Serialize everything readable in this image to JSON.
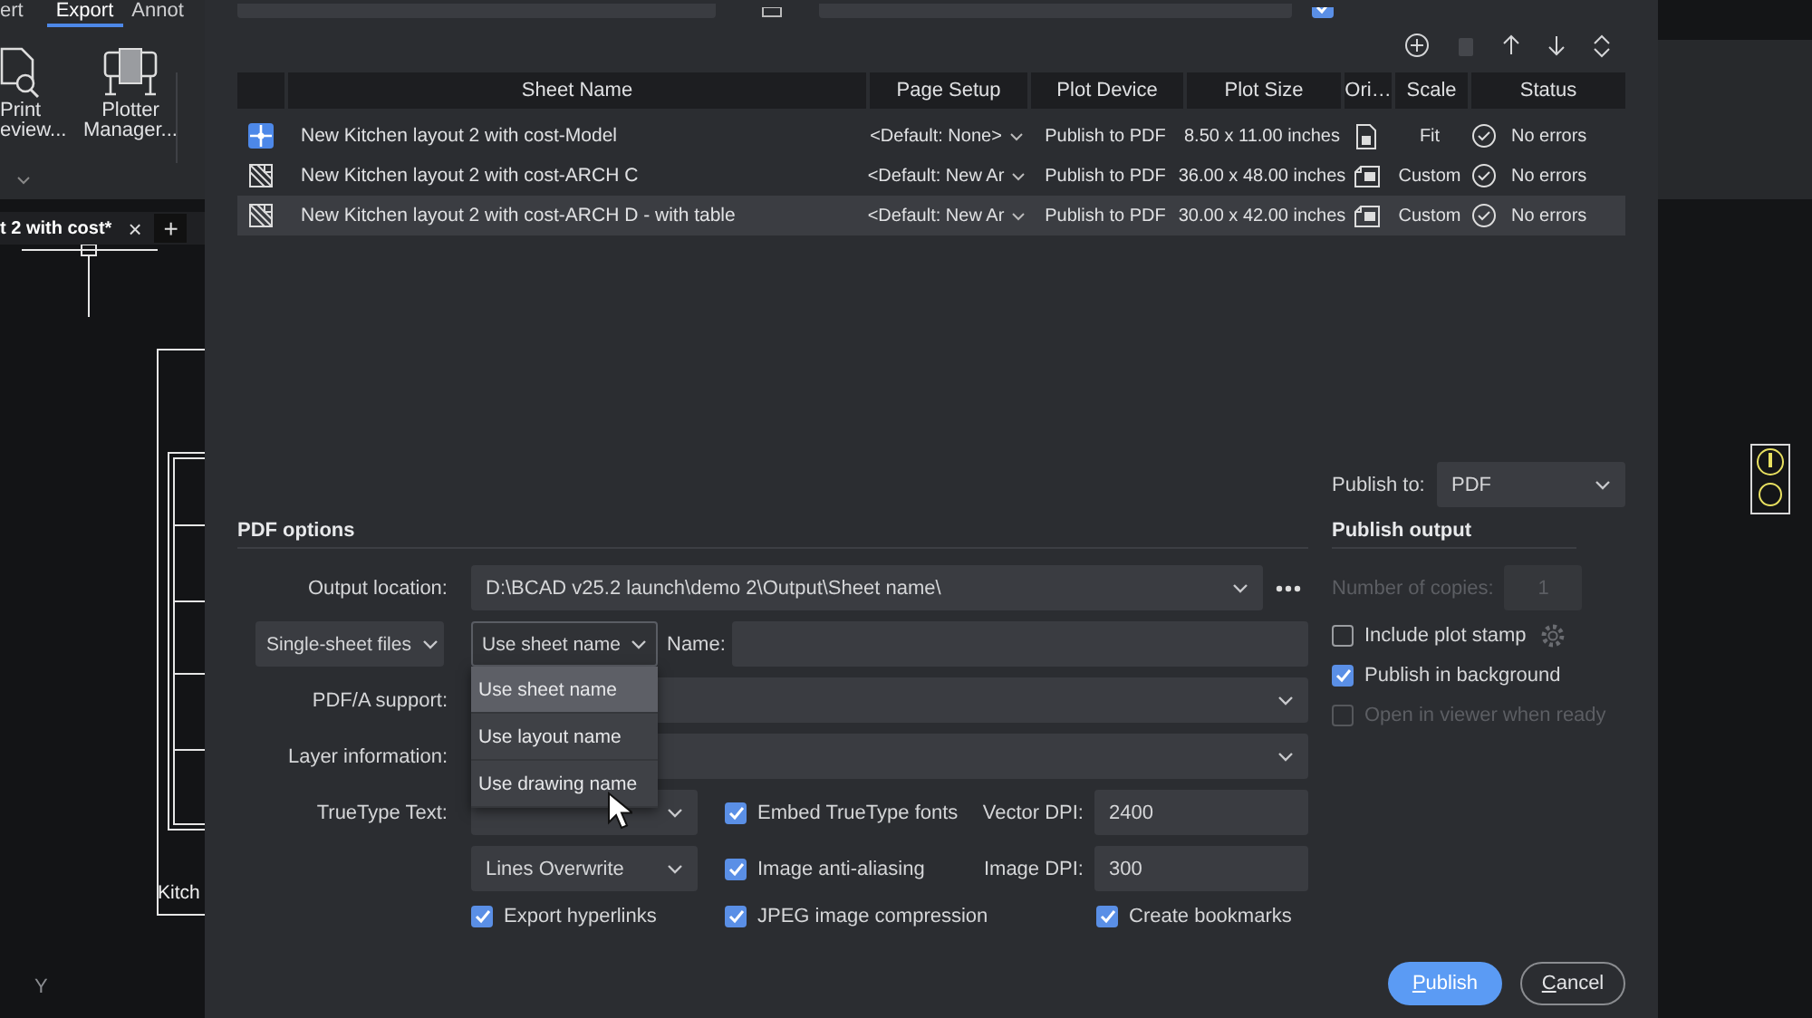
{
  "ribbon": {
    "tabs": [
      {
        "label": "ert",
        "selected": false
      },
      {
        "label": "Export",
        "selected": true
      },
      {
        "label": "Annot",
        "selected": false
      }
    ],
    "buttons": [
      {
        "kind": "preview",
        "lines": [
          "Print",
          "eview..."
        ]
      },
      {
        "kind": "plotter",
        "lines": [
          "Plotter",
          "Manager..."
        ]
      }
    ]
  },
  "document_tab": {
    "title": "t 2 with cost*",
    "close": "×",
    "add": "+"
  },
  "drawing": {
    "label": "Kitch",
    "axis": "Y"
  },
  "dialog": {
    "top_checkbox": {
      "checked": true
    },
    "toolbar": [
      {
        "kind": "add",
        "disabled": false
      },
      {
        "kind": "delete",
        "disabled": true
      },
      {
        "kind": "up",
        "disabled": false
      },
      {
        "kind": "down",
        "disabled": false
      },
      {
        "kind": "expand",
        "disabled": false
      }
    ],
    "sheets": {
      "columns": [
        "Sheet Name",
        "Page Setup",
        "Plot Device",
        "Plot Size",
        "Ori…",
        "Scale",
        "Status"
      ],
      "rows": [
        {
          "kind": "model",
          "sheet_name": "New Kitchen layout 2 with cost-Model",
          "page_setup": "<Default: None>",
          "plot_device": "Publish to PDF",
          "plot_size": "8.50 x 11.00 inches",
          "orientation": {
            "kind": "portrait"
          },
          "scale": "Fit",
          "status": "No errors",
          "selected": false
        },
        {
          "kind": "layout",
          "sheet_name": "New Kitchen layout 2 with cost-ARCH C",
          "page_setup": "<Default: New Ar",
          "plot_device": "Publish to PDF",
          "plot_size": "36.00 x 48.00 inches",
          "orientation": {
            "kind": "landscape"
          },
          "scale": "Custom",
          "status": "No errors",
          "selected": false
        },
        {
          "kind": "layout",
          "sheet_name": "New Kitchen layout 2 with cost-ARCH D - with table",
          "page_setup": "<Default: New Ar",
          "plot_device": "Publish to PDF",
          "plot_size": "30.00 x 42.00 inches",
          "orientation": {
            "kind": "landscape"
          },
          "scale": "Custom",
          "status": "No errors",
          "selected": true
        }
      ]
    },
    "publish_to": {
      "label": "Publish to:",
      "value": "PDF"
    },
    "pdf_options": {
      "heading": "PDF options",
      "output_location": {
        "label": "Output location:",
        "value": "D:\\BCAD v25.2 launch\\demo 2\\Output\\Sheet name\\"
      },
      "file_mode": {
        "value": "Single-sheet files"
      },
      "naming": {
        "value": "Use sheet name",
        "expanded": true,
        "options": [
          {
            "label": "Use sheet name",
            "selected": true
          },
          {
            "label": "Use layout name",
            "selected": false
          },
          {
            "label": "Use drawing name",
            "selected": false
          }
        ]
      },
      "name": {
        "label": "Name:"
      },
      "pdfa": {
        "label": "PDF/A support:"
      },
      "layer": {
        "label": "Layer information:"
      },
      "truetype": {
        "label": "TrueType Text:"
      },
      "lines": {
        "value": "Lines Overwrite"
      },
      "embed_fonts": {
        "label": "Embed TrueType fonts",
        "checked": true
      },
      "vector_dpi": {
        "label": "Vector DPI:",
        "value": "2400"
      },
      "anti_aliasing": {
        "label": "Image anti-aliasing",
        "checked": true
      },
      "image_dpi": {
        "label": "Image DPI:",
        "value": "300"
      },
      "export_hyperlinks": {
        "label": "Export hyperlinks",
        "checked": true
      },
      "jpeg_compression": {
        "label": "JPEG image compression",
        "checked": true
      },
      "create_bookmarks": {
        "label": "Create bookmarks",
        "checked": true
      }
    },
    "publish_output": {
      "heading": "Publish output",
      "copies": {
        "label": "Number of copies:",
        "value": "1",
        "disabled": true
      },
      "options": [
        {
          "kind": "stamp",
          "label": "Include plot stamp",
          "checked": false,
          "disabled": false
        },
        {
          "kind": "plain",
          "label": "Publish in background",
          "checked": true,
          "disabled": false
        },
        {
          "kind": "plain",
          "label": "Open in viewer when ready",
          "checked": false,
          "disabled": true
        }
      ]
    },
    "buttons": [
      {
        "kind": "primary",
        "label": "Publish"
      },
      {
        "kind": "secondary",
        "label": "Cancel"
      }
    ]
  }
}
